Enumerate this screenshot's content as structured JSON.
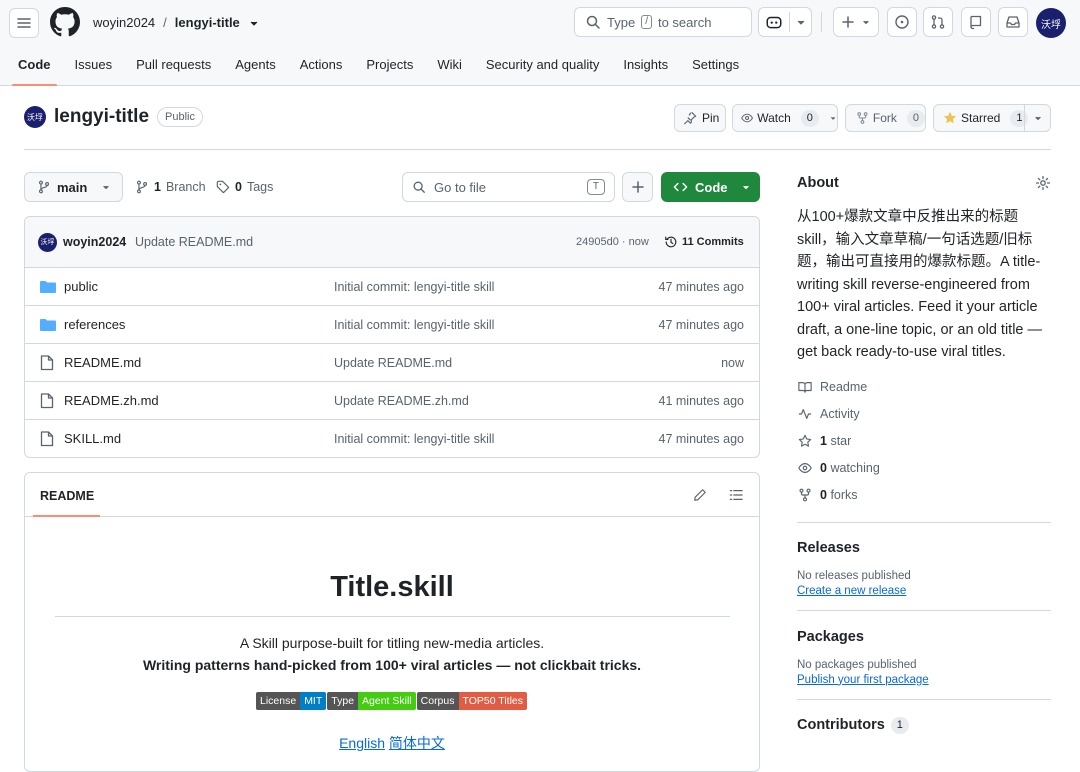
{
  "header": {
    "owner": "woyin2024",
    "separator": "/",
    "repo": "lengyi-title",
    "search_placeholder_pre": "Type",
    "search_key": "/",
    "search_placeholder_post": "to search",
    "avatar_text": "沃垺"
  },
  "nav": {
    "tabs": [
      {
        "label": "Code"
      },
      {
        "label": "Issues"
      },
      {
        "label": "Pull requests"
      },
      {
        "label": "Agents"
      },
      {
        "label": "Actions"
      },
      {
        "label": "Projects"
      },
      {
        "label": "Wiki"
      },
      {
        "label": "Security and quality"
      },
      {
        "label": "Insights"
      },
      {
        "label": "Settings"
      }
    ]
  },
  "repo": {
    "name": "lengyi-title",
    "visibility": "Public",
    "avatar_text": "沃垺",
    "pin": "Pin",
    "watch": "Watch",
    "watch_count": "0",
    "fork": "Fork",
    "fork_count": "0",
    "starred": "Starred",
    "star_count": "1"
  },
  "toolbar": {
    "branch": "main",
    "branch_count": "1",
    "branch_label": "Branch",
    "tag_count": "0",
    "tag_label": "Tags",
    "goto_placeholder": "Go to file",
    "goto_key": "T",
    "code_button": "Code"
  },
  "commit": {
    "author": "woyin2024",
    "message": "Update README.md",
    "hash_time": "24905d0 · now",
    "commits": "11 Commits"
  },
  "files": [
    {
      "type": "dir",
      "name": "public",
      "message": "Initial commit: lengyi-title skill",
      "time": "47 minutes ago"
    },
    {
      "type": "dir",
      "name": "references",
      "message": "Initial commit: lengyi-title skill",
      "time": "47 minutes ago"
    },
    {
      "type": "file",
      "name": "README.md",
      "message": "Update README.md",
      "time": "now"
    },
    {
      "type": "file",
      "name": "README.zh.md",
      "message": "Update README.zh.md",
      "time": "41 minutes ago"
    },
    {
      "type": "file",
      "name": "SKILL.md",
      "message": "Initial commit: lengyi-title skill",
      "time": "47 minutes ago"
    }
  ],
  "readme": {
    "tab": "README",
    "title": "Title.skill",
    "line1": "A Skill purpose-built for titling new-media articles.",
    "line2": "Writing patterns hand-picked from 100+ viral articles — not clickbait tricks.",
    "badges": [
      {
        "label": "License",
        "value": "MIT",
        "color": "#007ec6"
      },
      {
        "label": "Type",
        "value": "Agent Skill",
        "color": "#4c1"
      },
      {
        "label": "Corpus",
        "value": "TOP50 Titles",
        "color": "#e05d44"
      }
    ],
    "lang_en": "English",
    "lang_zh": "简体中文"
  },
  "about": {
    "heading": "About",
    "description": "从100+爆款文章中反推出来的标题skill，输入文章草稿/一句话选题/旧标题，输出可直接用的爆款标题。A title-writing skill reverse-engineered from 100+ viral articles. Feed it your article draft, a one-line topic, or an old title — get back ready-to-use viral titles.",
    "readme": "Readme",
    "activity": "Activity",
    "stars_count": "1",
    "stars_label": "star",
    "watching_count": "0",
    "watching_label": "watching",
    "forks_count": "0",
    "forks_label": "forks"
  },
  "releases": {
    "heading": "Releases",
    "none": "No releases published",
    "create": "Create a new release"
  },
  "packages": {
    "heading": "Packages",
    "none": "No packages published",
    "publish": "Publish your first package"
  },
  "contributors": {
    "heading": "Contributors",
    "count": "1"
  },
  "colors": {
    "accent": "#0969da",
    "green": "#1f883d",
    "tab_underline": "#fd8c73",
    "star": "#eac54f"
  }
}
